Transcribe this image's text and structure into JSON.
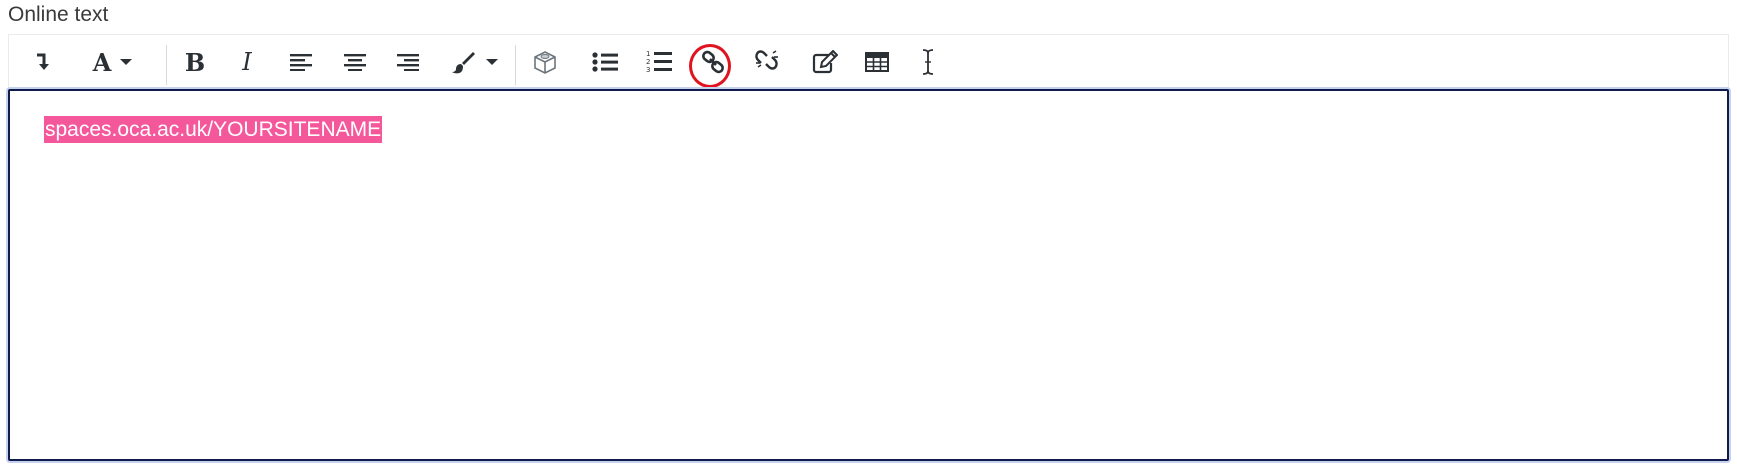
{
  "field": {
    "label": "Online text"
  },
  "toolbar": {
    "buttons": [
      {
        "name": "show-more-buttons-button",
        "icon": "level-down-icon"
      },
      {
        "name": "paragraph-style-button",
        "icon": "font-icon",
        "dropdown": true
      },
      {
        "name": "bold-button",
        "icon": "bold-icon"
      },
      {
        "name": "italic-button",
        "icon": "italic-icon"
      },
      {
        "name": "align-left-button",
        "icon": "align-left-icon"
      },
      {
        "name": "align-center-button",
        "icon": "align-center-icon"
      },
      {
        "name": "align-right-button",
        "icon": "align-right-icon"
      },
      {
        "name": "font-color-button",
        "icon": "paintbrush-icon",
        "dropdown": true
      },
      {
        "name": "insert-object-button",
        "icon": "cube-icon"
      },
      {
        "name": "unordered-list-button",
        "icon": "list-ul-icon"
      },
      {
        "name": "ordered-list-button",
        "icon": "list-ol-icon"
      },
      {
        "name": "link-button",
        "icon": "link-icon",
        "highlighted": true
      },
      {
        "name": "unlink-button",
        "icon": "unlink-icon"
      },
      {
        "name": "edit-source-button",
        "icon": "edit-icon"
      },
      {
        "name": "table-button",
        "icon": "table-icon"
      },
      {
        "name": "text-cursor-button",
        "icon": "i-beam-icon"
      }
    ]
  },
  "editor": {
    "content": "spaces.oca.ac.uk/YOURSITENAME",
    "selection_color": "#f5579b"
  },
  "annotation": {
    "ring_color": "#e0141e"
  }
}
